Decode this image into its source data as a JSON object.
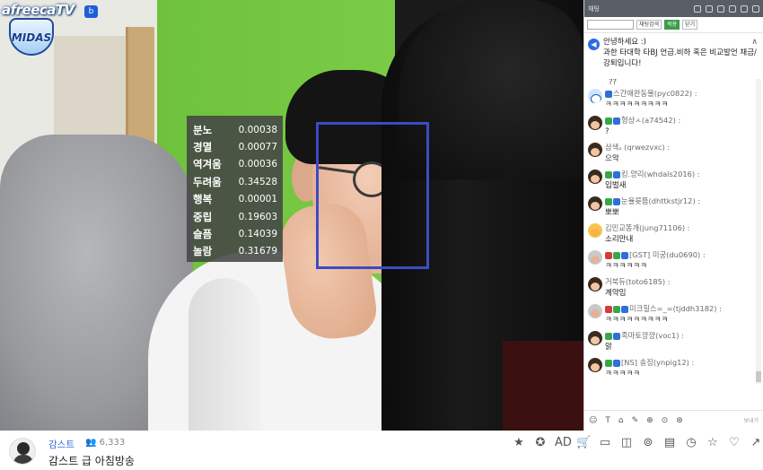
{
  "logo": {
    "brand": "afreecaTV",
    "badge": "b",
    "crest": "MIDAS"
  },
  "emotions": [
    {
      "label": "분노",
      "value": "0.00038"
    },
    {
      "label": "경멸",
      "value": "0.00077"
    },
    {
      "label": "역겨움",
      "value": "0.00036"
    },
    {
      "label": "두려움",
      "value": "0.34528"
    },
    {
      "label": "행복",
      "value": "0.00001"
    },
    {
      "label": "중립",
      "value": "0.19603"
    },
    {
      "label": "슬픔",
      "value": "0.14039"
    },
    {
      "label": "놀람",
      "value": "0.31679"
    }
  ],
  "chat": {
    "tab_label": "채팅",
    "search_option": "채팅검색",
    "search_button": "적용",
    "search_close": "닫기",
    "notice": "안녕하세요 :)\n과한 타대학 타BJ 언급.비하 혹은 비교발언 채금/강퇴입니다!",
    "first_text": "??",
    "messages": [
      {
        "user": "스간애완동물(pyc0822) :",
        "text": "ㅋㅋㅋㅋㅋㅋㅋㅋㅋ",
        "avatar": "blue",
        "badges": [
          "blue"
        ]
      },
      {
        "user": "형상ㅅ(a74542) :",
        "text": "?",
        "avatar": "dark",
        "badges": [
          "green",
          "blue"
        ]
      },
      {
        "user": "삼색ₐ (qrwezvxc) :",
        "text": "으악",
        "avatar": "dark",
        "badges": []
      },
      {
        "user": "킹.양리(whdals2016) :",
        "text": "입벌새",
        "avatar": "dark",
        "badges": [
          "green",
          "blue"
        ]
      },
      {
        "user": "눈율릇뜸(dhttkstjr12) :",
        "text": "뽀뽀",
        "avatar": "dark",
        "badges": [
          "green",
          "blue"
        ]
      },
      {
        "user": "김민교똥개(jung71106) :",
        "text": "소리만내",
        "avatar": "gold",
        "badges": []
      },
      {
        "user": "[GST] 미궁(du0690) :",
        "text": "ㅋㅋㅋㅋㅋㅋ",
        "avatar": "gray",
        "badges": [
          "red",
          "green",
          "blue"
        ]
      },
      {
        "user": "거북듀(toto6185) :",
        "text": "계약임",
        "avatar": "dark",
        "badges": []
      },
      {
        "user": "미크힐스=_=(tjddh3182) :",
        "text": "ㅋㅋㅋㅋㅋㅋㅋㅋㅋ",
        "avatar": "gray",
        "badges": [
          "red",
          "green",
          "blue"
        ]
      },
      {
        "user": "족마토깡깡(voc1) :",
        "text": "앍",
        "avatar": "dark",
        "badges": [
          "green",
          "blue"
        ]
      },
      {
        "user": "[NS] 송징(ynpig12) :",
        "text": "ㅋㅋㅋㅋㅋ",
        "avatar": "dark",
        "badges": [
          "green",
          "blue"
        ]
      }
    ],
    "input_icons": [
      "☺",
      "T",
      "⌂",
      "✎",
      "⊕",
      "⊙",
      "⊛"
    ],
    "send_label": "보내기"
  },
  "broadcast": {
    "streamer": "감스트",
    "viewers": "6,333",
    "title": "감스트 급 아침방송"
  },
  "action_icons": [
    "★",
    "✪",
    "AD",
    "🛒",
    "▭",
    "◫",
    "⊚",
    "▤",
    "◷",
    "☆",
    "♡",
    "↗"
  ]
}
